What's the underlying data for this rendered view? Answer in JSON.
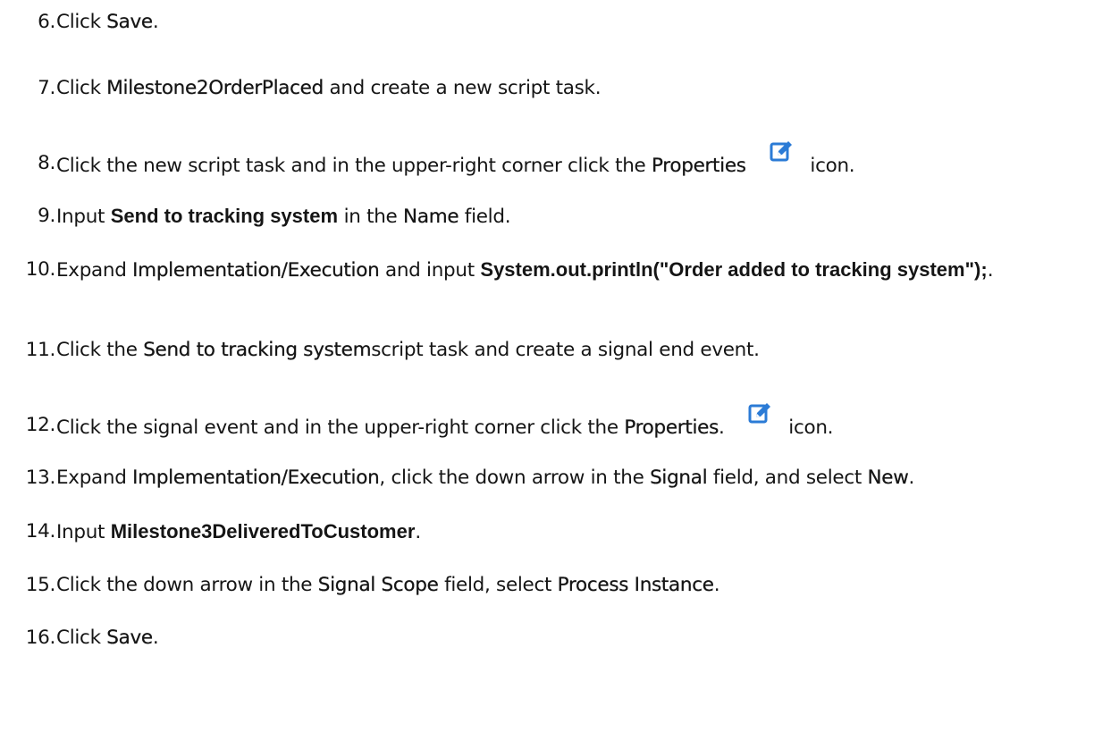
{
  "steps": [
    {
      "num": "6.",
      "t1": "Click ",
      "b1": "Save",
      "t2": "."
    },
    {
      "num": "7.",
      "t1": "Click ",
      "b1": "Milestone2OrderPlaced",
      "t2": " and create a new script task."
    },
    {
      "num": "8.",
      "t1": "Click the new script task and in the upper-right corner click the ",
      "b1": "Properties",
      "t2": " icon."
    },
    {
      "num": "9.",
      "t1": "Input ",
      "u1": "Send to tracking system",
      "t2": " in the ",
      "b1": "Name",
      "t3": " field."
    },
    {
      "num": "10.",
      "t1": "Expand ",
      "b1": "Implementation/Execution",
      "t2": " and input ",
      "u1": "System.out.println(\"Order added to tracking system\");",
      "t3": "."
    },
    {
      "num": "11.",
      "t1": "Click the ",
      "b1": "Send to tracking system",
      "t2": "script task and create a signal end event."
    },
    {
      "num": "12.",
      "t1": "Click the signal event and in the upper-right corner click the ",
      "b1": "Properties",
      "t2": ".",
      "t3": " icon."
    },
    {
      "num": "13.",
      "t1": "Expand ",
      "b1": "Implementation/Execution",
      "t2": ", click the down arrow in the ",
      "b2": "Signal",
      "t3": " field, and select ",
      "b3": "New",
      "t4": "."
    },
    {
      "num": "14.",
      "t1": "Input ",
      "u1": "Milestone3DeliveredToCustomer",
      "t2": "."
    },
    {
      "num": "15.",
      "t1": "Click the down arrow in the ",
      "b1": "Signal Scope",
      "t2": " field, select ",
      "b2": "Process Instance",
      "t3": "."
    },
    {
      "num": "16.",
      "t1": "Click ",
      "b1": "Save",
      "t2": "."
    }
  ],
  "icons": {
    "properties": "edit-properties-icon",
    "color": "#2b7bd6"
  }
}
